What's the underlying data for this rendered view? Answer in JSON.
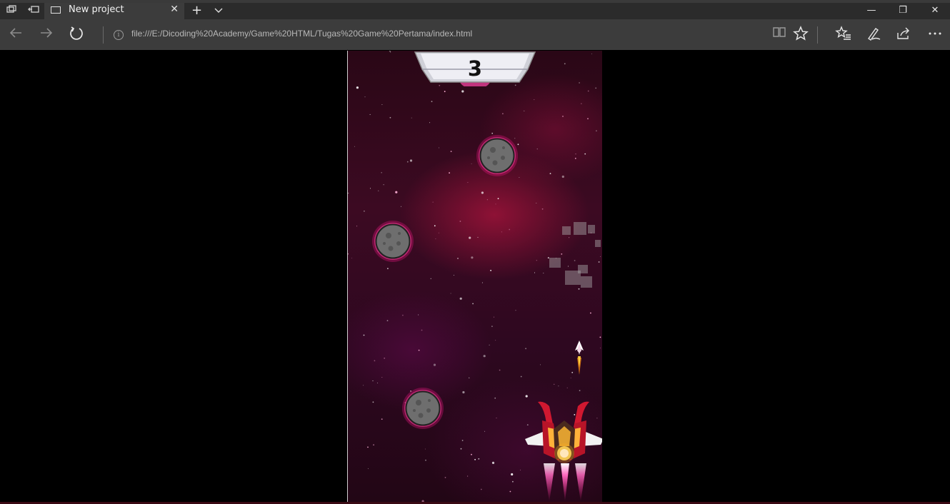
{
  "browser": {
    "tab_title": "New project",
    "tab_close_glyph": "✕",
    "new_tab_glyph": "+",
    "url": "file:///E:/Dicoding%20Academy/Game%20HTML/Tugas%20Game%20Pertama/index.html",
    "icons": {
      "back": "back-arrow-icon",
      "forward": "forward-arrow-icon",
      "refresh": "refresh-icon",
      "info": "info-icon",
      "reading_view": "reading-view-icon",
      "favorite": "star-icon",
      "favorites_hub": "favorites-list-icon",
      "notes": "pen-icon",
      "share": "share-icon",
      "more": "more-icon"
    },
    "window_controls": {
      "minimize": "—",
      "restore": "❐",
      "close": "✕"
    }
  },
  "game": {
    "score": "3",
    "colors": {
      "background_dark": "#2a0716",
      "nebula": "#aa143c",
      "asteroid_glow": "#e0157a",
      "asteroid_body": "#6e6e6e",
      "plate": "#e8e8ee"
    }
  }
}
